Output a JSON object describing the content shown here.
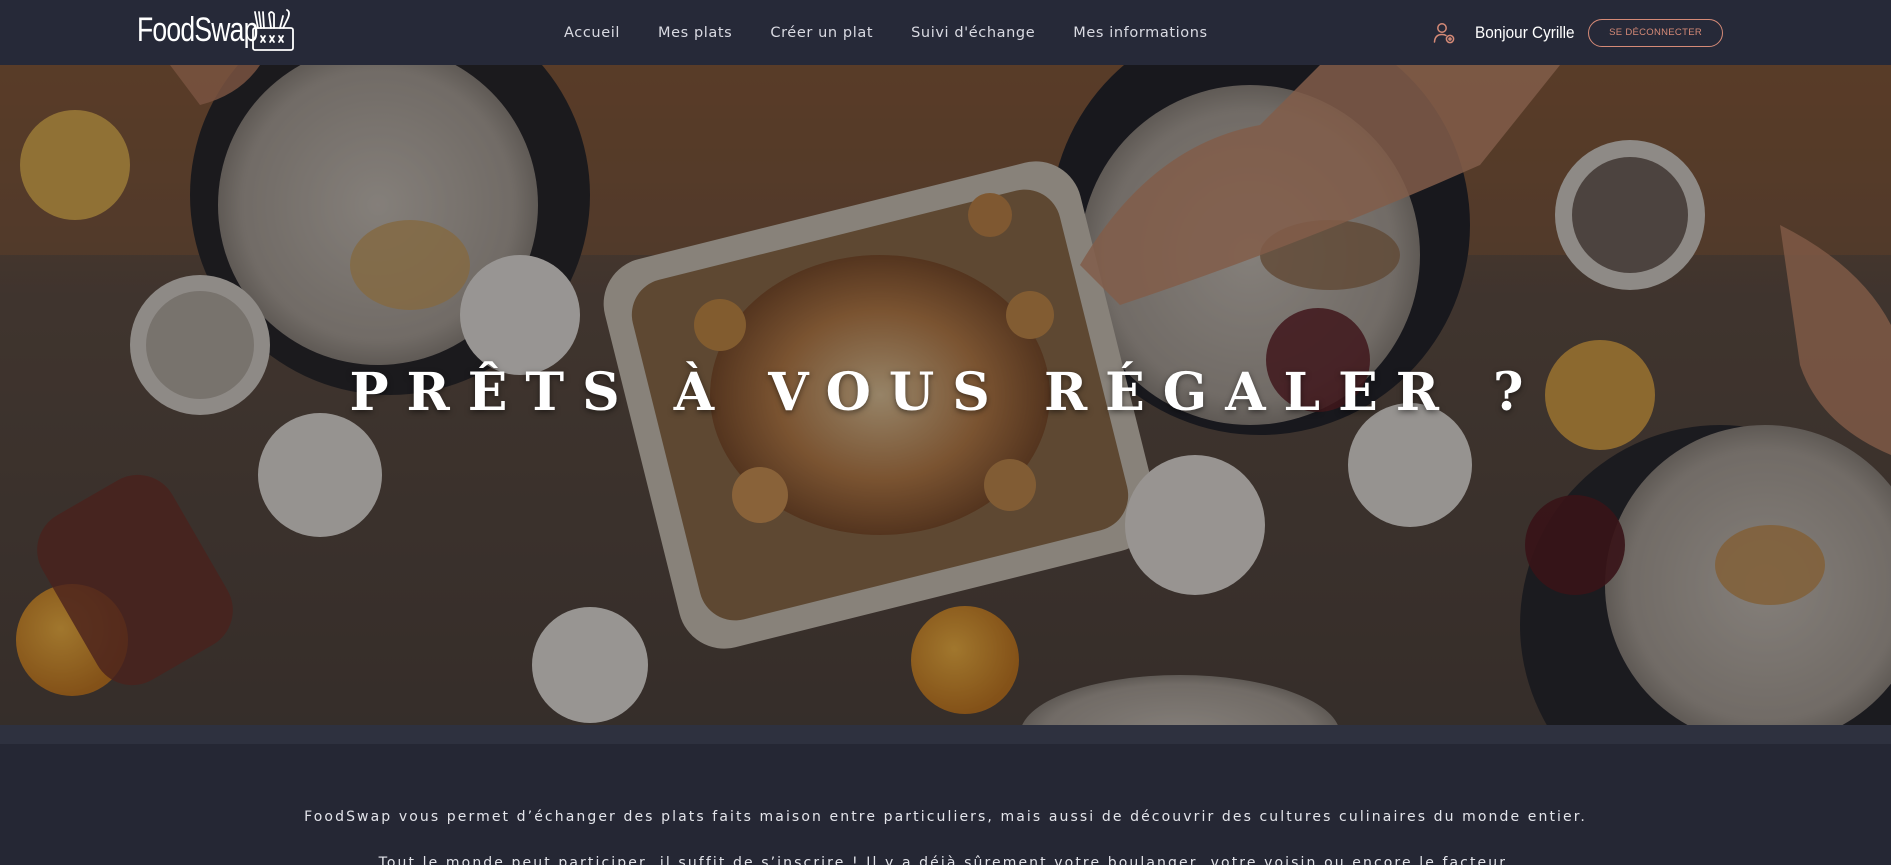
{
  "navbar": {
    "logo_text": "FoodSwap",
    "logo_icon": "cutlery-basket-icon",
    "links": [
      {
        "label": "Accueil"
      },
      {
        "label": "Mes plats"
      },
      {
        "label": "Créer un plat"
      },
      {
        "label": "Suivi d'échange"
      },
      {
        "label": "Mes informations"
      }
    ],
    "user_icon": "user-settings-icon",
    "greeting": "Bonjour Cyrille",
    "logout_label": "SE DÉCONNECTER"
  },
  "hero": {
    "title": "PRÊTS À VOUS RÉGALER ?"
  },
  "content": {
    "paragraph_1": "FoodSwap vous permet d’échanger des plats faits maison entre particuliers, mais aussi de découvrir des cultures culinaires du monde entier.",
    "paragraph_2": "Tout le monde peut participer, il suffit de s’inscrire ! Il y a déjà sûrement votre boulanger, votre voisin ou encore le facteur."
  },
  "colors": {
    "navbar_bg": "#262938",
    "page_bg": "#252734",
    "accent": "#d58a77"
  }
}
